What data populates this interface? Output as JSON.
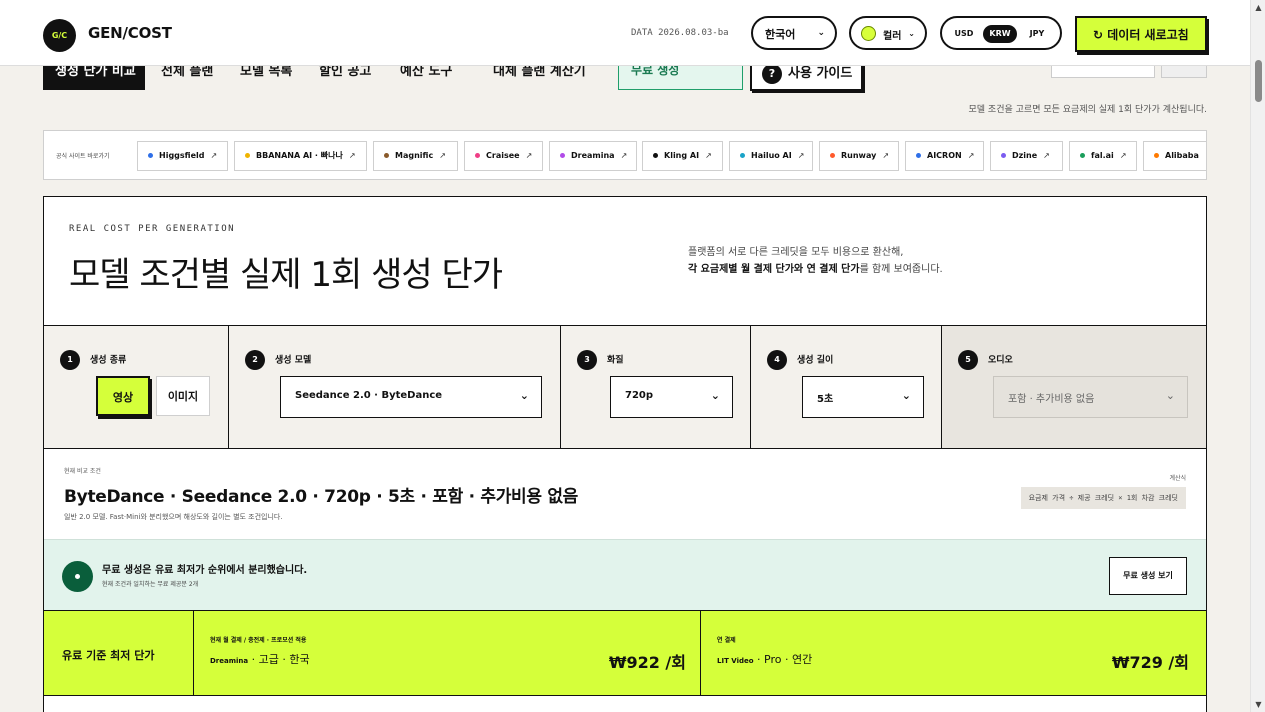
{
  "header": {
    "logo_badge": "G/C",
    "logo_text": "GEN/COST",
    "data_stamp": "DATA 2026.08.03-ba",
    "language": "한국어",
    "color_label": "컬러",
    "currencies": [
      "USD",
      "KRW",
      "JPY"
    ],
    "active_currency": "KRW",
    "refresh_label": "↻ 데이터 새로고침",
    "accent_color": "#d5ff3a"
  },
  "nav": {
    "items": [
      "생성 단가 비교",
      "전체 플랜",
      "모델 목록",
      "할인 공고",
      "예산 도구",
      "대체 플랜 계산기"
    ],
    "free_label": "무료 생성",
    "guide_label": "사용 가이드"
  },
  "hint": "모델 조건을 고르면 모든 요금제의 실제 1회 단가가 계산됩니다.",
  "sites": {
    "label": "공식 사이트 바로가기",
    "items": [
      {
        "name": "Higgsfield",
        "color": "#2f6fe8"
      },
      {
        "name": "BBANANA AI · 빠나나",
        "color": "#f0b400"
      },
      {
        "name": "Magnific",
        "color": "#8a5a2b"
      },
      {
        "name": "Craisee",
        "color": "#ef3e86"
      },
      {
        "name": "Dreamina",
        "color": "#b14be8"
      },
      {
        "name": "Kling AI",
        "color": "#111111"
      },
      {
        "name": "Hailuo AI",
        "color": "#1aa3c8"
      },
      {
        "name": "Runway",
        "color": "#ff5a2c"
      },
      {
        "name": "AICRON",
        "color": "#2f6fe8"
      },
      {
        "name": "Dzine",
        "color": "#7b5cf0"
      },
      {
        "name": "fal.ai",
        "color": "#1b9e5b"
      },
      {
        "name": "Alibaba",
        "color": "#ff7a00"
      }
    ],
    "arrow": "↗"
  },
  "hero": {
    "eyebrow": "REAL COST PER GENERATION",
    "title": "모델 조건별 실제 1회 생성 단가",
    "desc_line1": "플랫폼의 서로 다른 크레딧을 모두 비용으로 환산해,",
    "desc_bold": "각 요금제별 월 결제 단가와 연 결제 단가",
    "desc_tail": "를 함께 보여줍니다."
  },
  "steps": {
    "s1": {
      "num": "1",
      "label": "생성 종류",
      "options": [
        "영상",
        "이미지"
      ],
      "selected": "영상"
    },
    "s2": {
      "num": "2",
      "label": "생성 모델",
      "value": "Seedance 2.0 · ByteDance"
    },
    "s3": {
      "num": "3",
      "label": "화질",
      "value": "720p"
    },
    "s4": {
      "num": "4",
      "label": "생성 길이",
      "value": "5초"
    },
    "s5": {
      "num": "5",
      "label": "오디오",
      "value": "포함 · 추가비용 없음"
    }
  },
  "condition": {
    "label": "현재 비교 조건",
    "title": "ByteDance · Seedance 2.0 · 720p · 5초 · 포함 · 추가비용 없음",
    "sub": "일반 2.0 모델. Fast·Mini와 분리했으며 해상도와 길이는 별도 조건입니다.",
    "formula_label": "계산식",
    "formula": "요금제 가격 ÷ 제공 크레딧 × 1회 차감 크레딧"
  },
  "free": {
    "title": "무료 생성은 유료 최저가 순위에서 분리했습니다.",
    "sub": "현재 조건과 일치하는 무료 제공분 2개",
    "button": "무료 생성 보기"
  },
  "best": {
    "label": "유료 기준 최저 단가",
    "monthly_small": "현재 월 결제 / 충전제 · 프로모션 적용",
    "monthly_pre": "Dreamina",
    "monthly_plan": " · 고급 · 한국",
    "monthly_price": "₩922 /회",
    "yearly_small": "연 결제",
    "yearly_pre": "LIT Video",
    "yearly_plan": " · Pro · 연간",
    "yearly_price": "₩729 /회"
  }
}
